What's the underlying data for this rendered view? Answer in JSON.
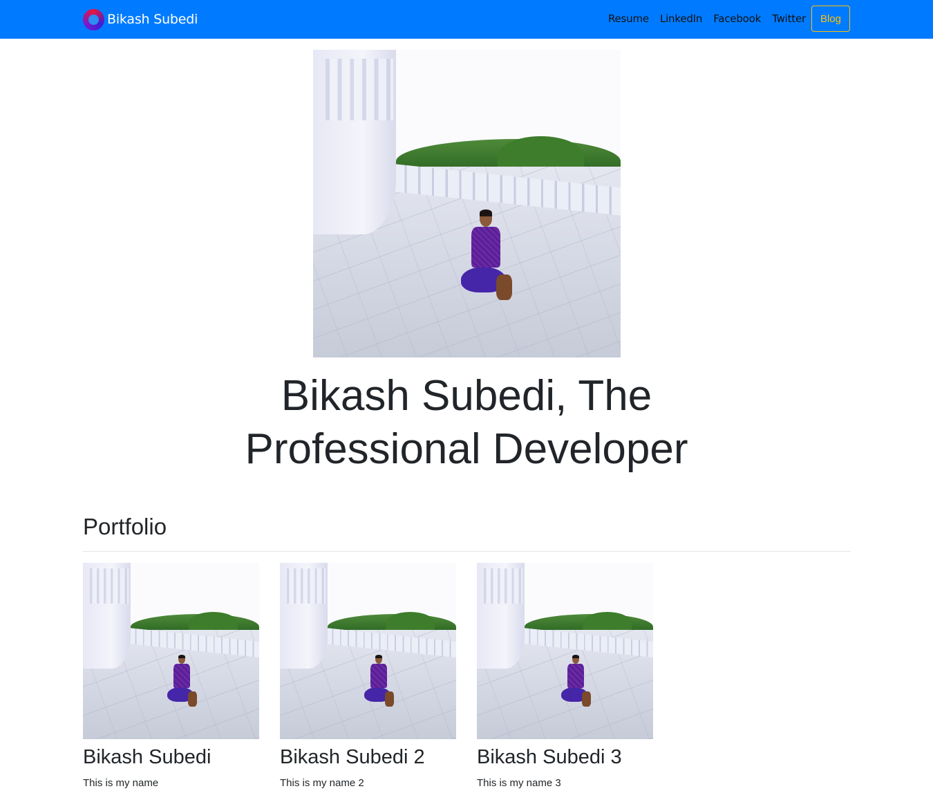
{
  "navbar": {
    "brand_text": "Bikash Subedi",
    "logo_icon": "ring-logo-icon",
    "links": [
      {
        "label": "Resume"
      },
      {
        "label": "LinkedIn"
      },
      {
        "label": "Facebook"
      },
      {
        "label": "Twitter"
      }
    ],
    "blog_label": "Blog",
    "colors": {
      "background": "#007bff",
      "blog_outline": "#ffc107"
    }
  },
  "hero": {
    "title": "Bikash Subedi, The Professional Developer"
  },
  "portfolio": {
    "heading": "Portfolio",
    "items": [
      {
        "title": "Bikash Subedi",
        "text": "This is my name"
      },
      {
        "title": "Bikash Subedi 2",
        "text": "This is my name 2"
      },
      {
        "title": "Bikash Subedi 3",
        "text": "This is my name 3"
      }
    ]
  }
}
